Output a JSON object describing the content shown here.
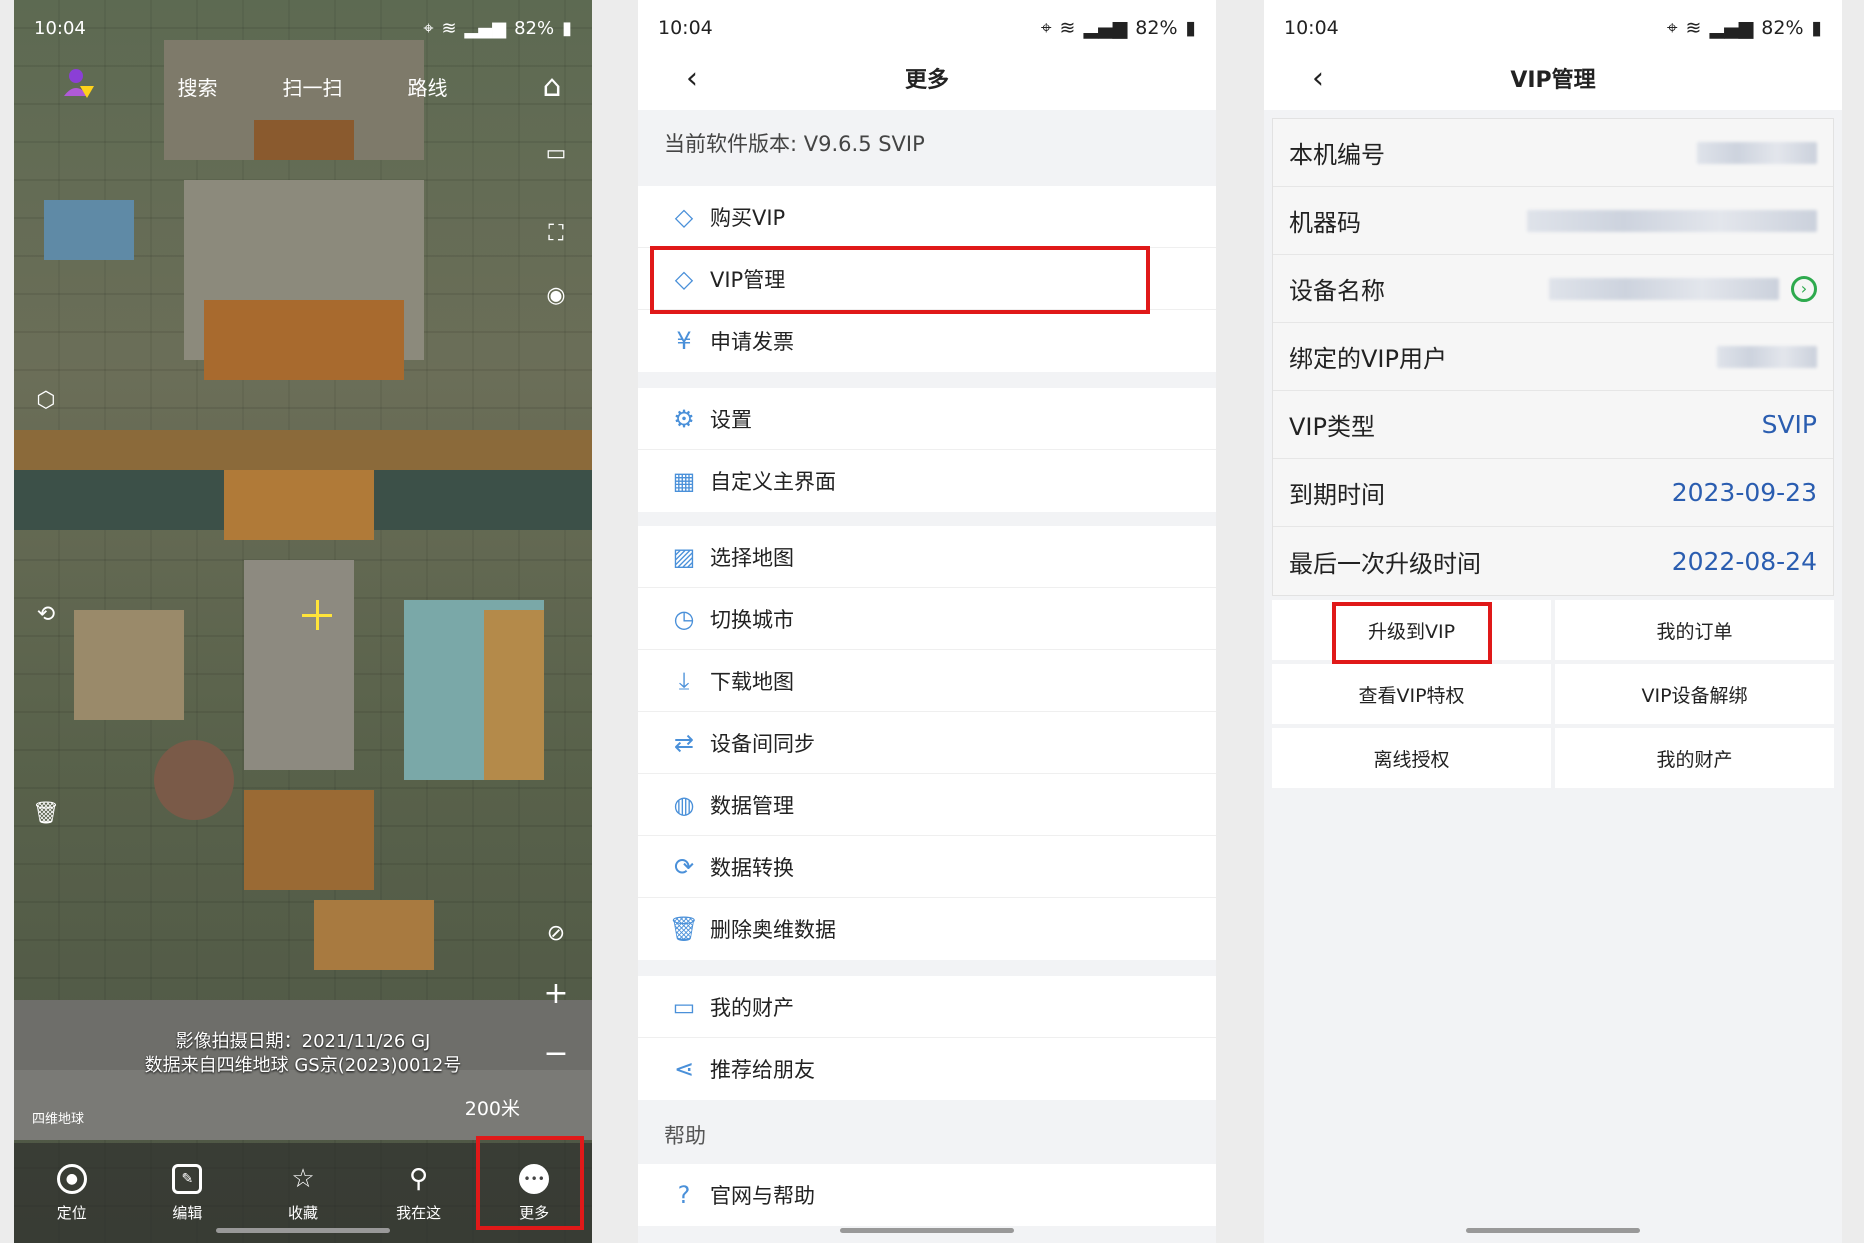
{
  "panel_map": {
    "status": {
      "time": "10:04",
      "battery": "82%"
    },
    "top_actions": [
      "搜索",
      "扫一扫",
      "路线"
    ],
    "image_date": "影像拍摄日期：2021/11/26 GJ",
    "data_source": "数据来自四维地球 GS京(2023)0012号",
    "scale": "200米",
    "brand": "四维地球",
    "bottom_tabs": [
      {
        "label": "定位",
        "icon": "locate-icon"
      },
      {
        "label": "编辑",
        "icon": "edit-icon"
      },
      {
        "label": "收藏",
        "icon": "star-icon"
      },
      {
        "label": "我在这",
        "icon": "pin-icon"
      },
      {
        "label": "更多",
        "icon": "more-icon"
      }
    ]
  },
  "panel_more": {
    "status": {
      "time": "10:04",
      "battery": "82%"
    },
    "title": "更多",
    "version": "当前软件版本: V9.6.5 SVIP",
    "group1": [
      {
        "label": "购买VIP",
        "icon": "diamond-icon"
      },
      {
        "label": "VIP管理",
        "icon": "diamond-icon"
      },
      {
        "label": "申请发票",
        "icon": "invoice-icon"
      }
    ],
    "group2": [
      {
        "label": "设置",
        "icon": "gear-icon"
      },
      {
        "label": "自定义主界面",
        "icon": "grid-icon"
      }
    ],
    "group3": [
      {
        "label": "选择地图",
        "icon": "map-icon"
      },
      {
        "label": "切换城市",
        "icon": "city-icon"
      },
      {
        "label": "下载地图",
        "icon": "download-icon"
      },
      {
        "label": "设备间同步",
        "icon": "sync-icon"
      },
      {
        "label": "数据管理",
        "icon": "globe-icon"
      },
      {
        "label": "数据转换",
        "icon": "convert-icon"
      },
      {
        "label": "删除奥维数据",
        "icon": "trash-icon"
      }
    ],
    "group4": [
      {
        "label": "我的财产",
        "icon": "wallet-icon"
      },
      {
        "label": "推荐给朋友",
        "icon": "share-icon"
      }
    ],
    "help_label": "帮助",
    "group5": [
      {
        "label": "官网与帮助",
        "icon": "help-icon"
      }
    ]
  },
  "panel_vip": {
    "status": {
      "time": "10:04",
      "battery": "82%"
    },
    "title": "VIP管理",
    "rows": [
      {
        "label": "本机编号",
        "value": ""
      },
      {
        "label": "机器码",
        "value": ""
      },
      {
        "label": "设备名称",
        "value": ""
      },
      {
        "label": "绑定的VIP用户",
        "value": ""
      },
      {
        "label": "VIP类型",
        "value": "SVIP"
      },
      {
        "label": "到期时间",
        "value": "2023-09-23"
      },
      {
        "label": "最后一次升级时间",
        "value": "2022-08-24"
      }
    ],
    "actions": [
      "升级到VIP",
      "我的订单",
      "查看VIP特权",
      "VIP设备解绑",
      "离线授权",
      "我的财产"
    ]
  }
}
